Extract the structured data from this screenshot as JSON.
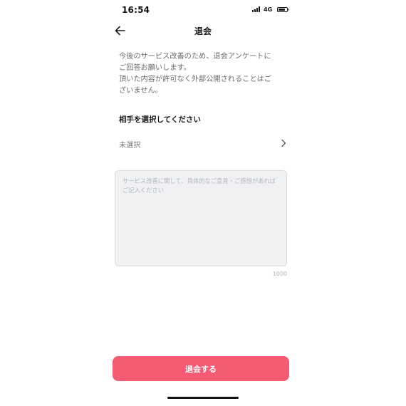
{
  "status_bar": {
    "time": "16:54",
    "network": "4G",
    "battery_level": 0.85
  },
  "nav": {
    "title": "退会",
    "back_icon": "arrow-left-icon"
  },
  "intro": {
    "line1": "今後のサービス改善のため、退会アンケートに",
    "line2": "ご回答お願いします。",
    "line3": "頂いた内容が許可なく外部公開されることはご",
    "line4": "ざいません。"
  },
  "partner_section": {
    "heading": "相手を選択してください",
    "selected_value": "未選択",
    "chevron_icon": "chevron-right-icon"
  },
  "feedback": {
    "value": "",
    "placeholder": "サービス改善に関して、具体的なご意見・ご感想があればご記入ください",
    "max_length": "1000"
  },
  "submit": {
    "label": "退会する",
    "color": "#f55c73"
  }
}
